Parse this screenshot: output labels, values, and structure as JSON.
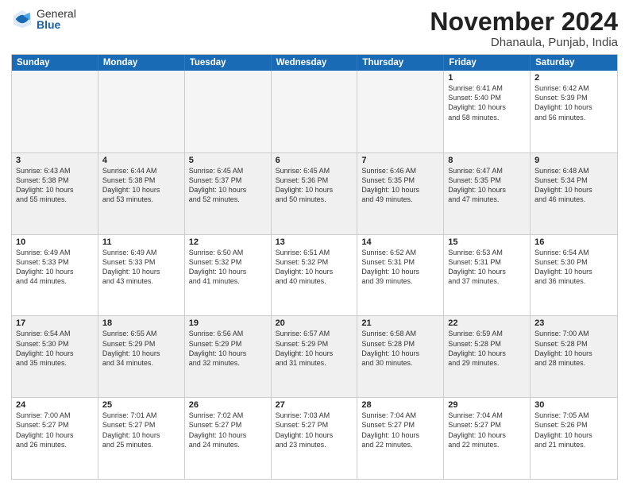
{
  "header": {
    "logo_general": "General",
    "logo_blue": "Blue",
    "month_title": "November 2024",
    "location": "Dhanaula, Punjab, India"
  },
  "weekdays": [
    "Sunday",
    "Monday",
    "Tuesday",
    "Wednesday",
    "Thursday",
    "Friday",
    "Saturday"
  ],
  "rows": [
    [
      {
        "day": "",
        "detail": "",
        "empty": true
      },
      {
        "day": "",
        "detail": "",
        "empty": true
      },
      {
        "day": "",
        "detail": "",
        "empty": true
      },
      {
        "day": "",
        "detail": "",
        "empty": true
      },
      {
        "day": "",
        "detail": "",
        "empty": true
      },
      {
        "day": "1",
        "detail": "Sunrise: 6:41 AM\nSunset: 5:40 PM\nDaylight: 10 hours\nand 58 minutes.",
        "empty": false
      },
      {
        "day": "2",
        "detail": "Sunrise: 6:42 AM\nSunset: 5:39 PM\nDaylight: 10 hours\nand 56 minutes.",
        "empty": false
      }
    ],
    [
      {
        "day": "3",
        "detail": "Sunrise: 6:43 AM\nSunset: 5:38 PM\nDaylight: 10 hours\nand 55 minutes.",
        "empty": false
      },
      {
        "day": "4",
        "detail": "Sunrise: 6:44 AM\nSunset: 5:38 PM\nDaylight: 10 hours\nand 53 minutes.",
        "empty": false
      },
      {
        "day": "5",
        "detail": "Sunrise: 6:45 AM\nSunset: 5:37 PM\nDaylight: 10 hours\nand 52 minutes.",
        "empty": false
      },
      {
        "day": "6",
        "detail": "Sunrise: 6:45 AM\nSunset: 5:36 PM\nDaylight: 10 hours\nand 50 minutes.",
        "empty": false
      },
      {
        "day": "7",
        "detail": "Sunrise: 6:46 AM\nSunset: 5:35 PM\nDaylight: 10 hours\nand 49 minutes.",
        "empty": false
      },
      {
        "day": "8",
        "detail": "Sunrise: 6:47 AM\nSunset: 5:35 PM\nDaylight: 10 hours\nand 47 minutes.",
        "empty": false
      },
      {
        "day": "9",
        "detail": "Sunrise: 6:48 AM\nSunset: 5:34 PM\nDaylight: 10 hours\nand 46 minutes.",
        "empty": false
      }
    ],
    [
      {
        "day": "10",
        "detail": "Sunrise: 6:49 AM\nSunset: 5:33 PM\nDaylight: 10 hours\nand 44 minutes.",
        "empty": false
      },
      {
        "day": "11",
        "detail": "Sunrise: 6:49 AM\nSunset: 5:33 PM\nDaylight: 10 hours\nand 43 minutes.",
        "empty": false
      },
      {
        "day": "12",
        "detail": "Sunrise: 6:50 AM\nSunset: 5:32 PM\nDaylight: 10 hours\nand 41 minutes.",
        "empty": false
      },
      {
        "day": "13",
        "detail": "Sunrise: 6:51 AM\nSunset: 5:32 PM\nDaylight: 10 hours\nand 40 minutes.",
        "empty": false
      },
      {
        "day": "14",
        "detail": "Sunrise: 6:52 AM\nSunset: 5:31 PM\nDaylight: 10 hours\nand 39 minutes.",
        "empty": false
      },
      {
        "day": "15",
        "detail": "Sunrise: 6:53 AM\nSunset: 5:31 PM\nDaylight: 10 hours\nand 37 minutes.",
        "empty": false
      },
      {
        "day": "16",
        "detail": "Sunrise: 6:54 AM\nSunset: 5:30 PM\nDaylight: 10 hours\nand 36 minutes.",
        "empty": false
      }
    ],
    [
      {
        "day": "17",
        "detail": "Sunrise: 6:54 AM\nSunset: 5:30 PM\nDaylight: 10 hours\nand 35 minutes.",
        "empty": false
      },
      {
        "day": "18",
        "detail": "Sunrise: 6:55 AM\nSunset: 5:29 PM\nDaylight: 10 hours\nand 34 minutes.",
        "empty": false
      },
      {
        "day": "19",
        "detail": "Sunrise: 6:56 AM\nSunset: 5:29 PM\nDaylight: 10 hours\nand 32 minutes.",
        "empty": false
      },
      {
        "day": "20",
        "detail": "Sunrise: 6:57 AM\nSunset: 5:29 PM\nDaylight: 10 hours\nand 31 minutes.",
        "empty": false
      },
      {
        "day": "21",
        "detail": "Sunrise: 6:58 AM\nSunset: 5:28 PM\nDaylight: 10 hours\nand 30 minutes.",
        "empty": false
      },
      {
        "day": "22",
        "detail": "Sunrise: 6:59 AM\nSunset: 5:28 PM\nDaylight: 10 hours\nand 29 minutes.",
        "empty": false
      },
      {
        "day": "23",
        "detail": "Sunrise: 7:00 AM\nSunset: 5:28 PM\nDaylight: 10 hours\nand 28 minutes.",
        "empty": false
      }
    ],
    [
      {
        "day": "24",
        "detail": "Sunrise: 7:00 AM\nSunset: 5:27 PM\nDaylight: 10 hours\nand 26 minutes.",
        "empty": false
      },
      {
        "day": "25",
        "detail": "Sunrise: 7:01 AM\nSunset: 5:27 PM\nDaylight: 10 hours\nand 25 minutes.",
        "empty": false
      },
      {
        "day": "26",
        "detail": "Sunrise: 7:02 AM\nSunset: 5:27 PM\nDaylight: 10 hours\nand 24 minutes.",
        "empty": false
      },
      {
        "day": "27",
        "detail": "Sunrise: 7:03 AM\nSunset: 5:27 PM\nDaylight: 10 hours\nand 23 minutes.",
        "empty": false
      },
      {
        "day": "28",
        "detail": "Sunrise: 7:04 AM\nSunset: 5:27 PM\nDaylight: 10 hours\nand 22 minutes.",
        "empty": false
      },
      {
        "day": "29",
        "detail": "Sunrise: 7:04 AM\nSunset: 5:27 PM\nDaylight: 10 hours\nand 22 minutes.",
        "empty": false
      },
      {
        "day": "30",
        "detail": "Sunrise: 7:05 AM\nSunset: 5:26 PM\nDaylight: 10 hours\nand 21 minutes.",
        "empty": false
      }
    ]
  ]
}
